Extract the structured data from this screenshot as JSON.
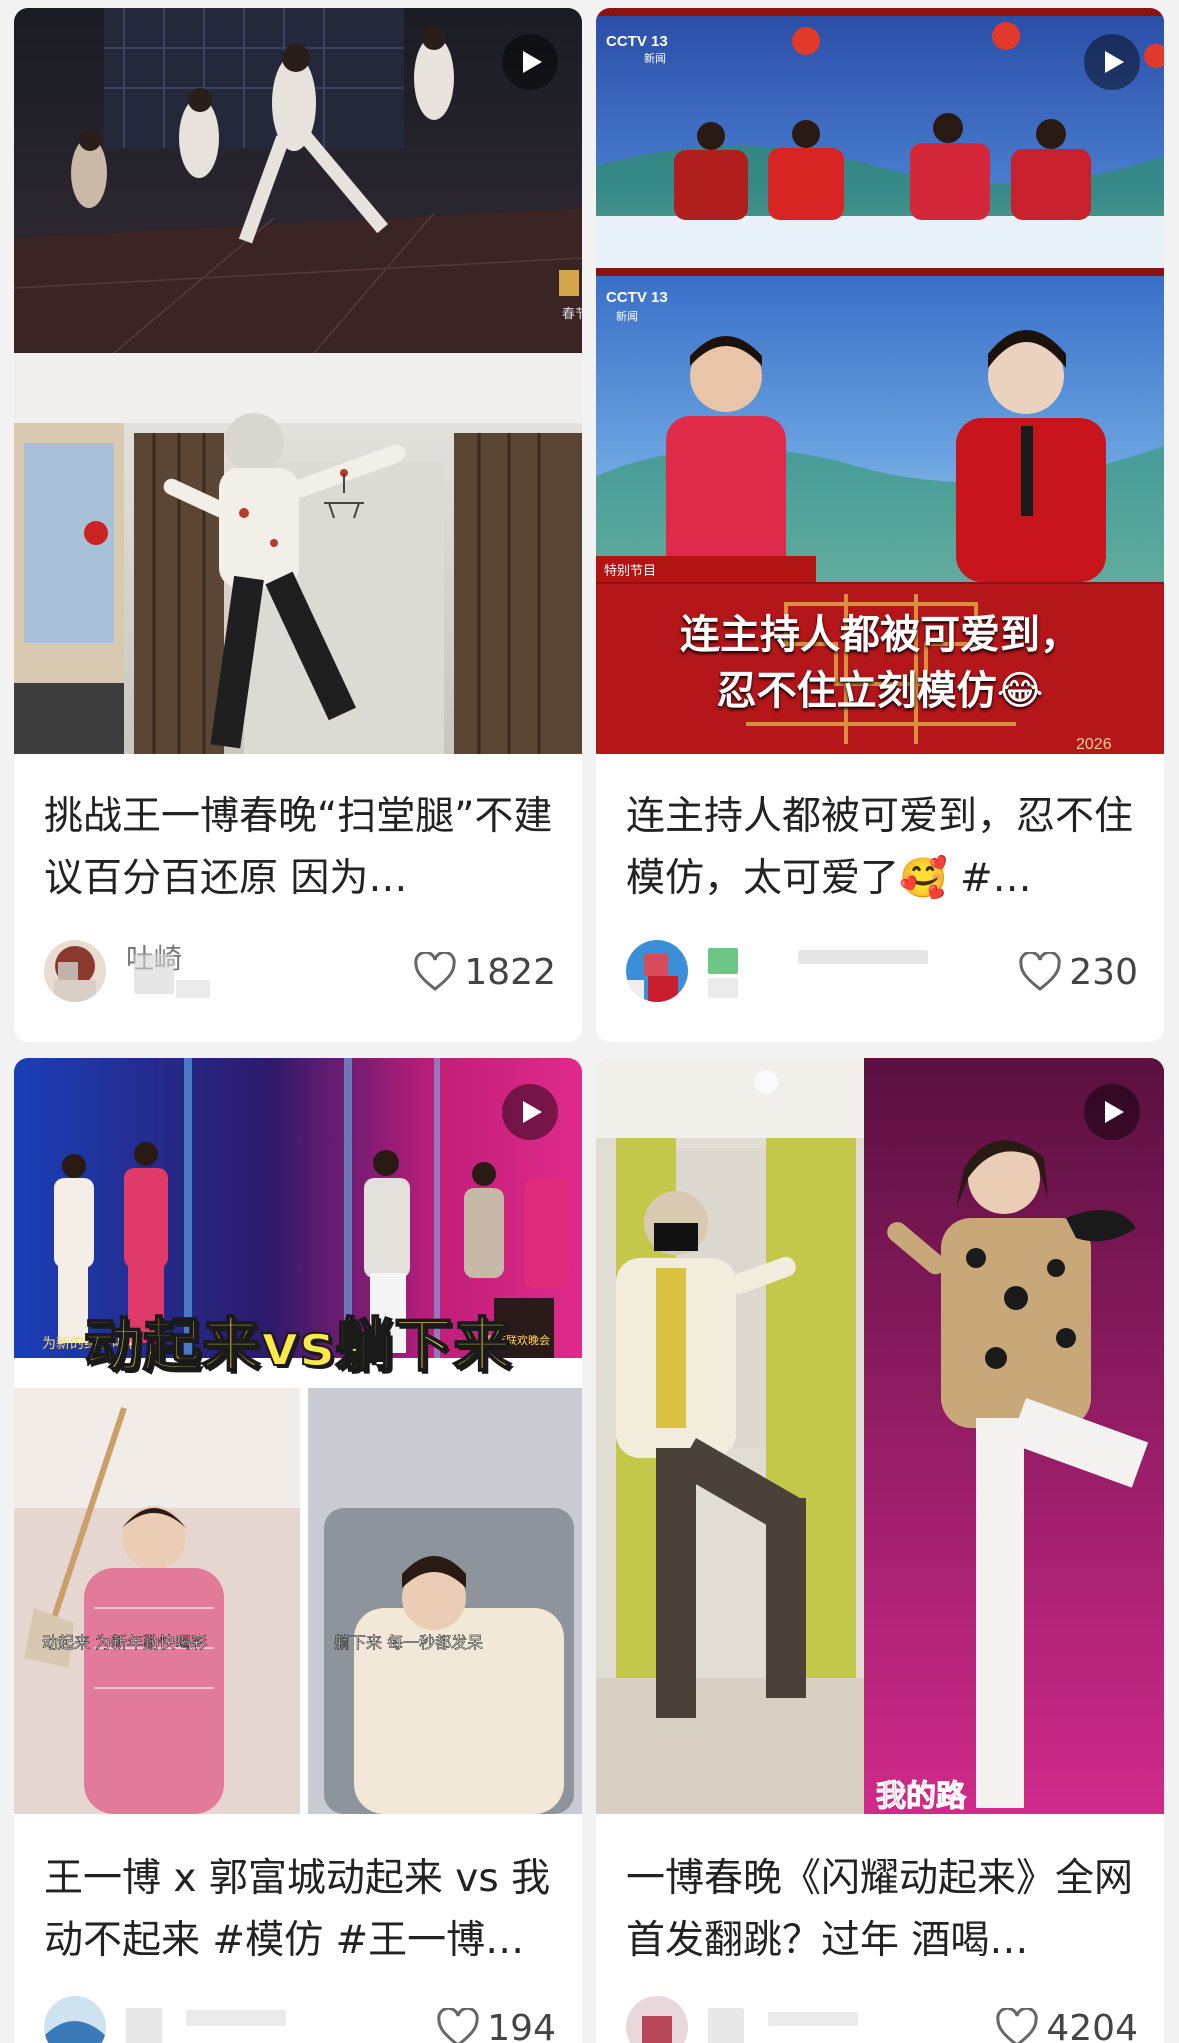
{
  "cards": [
    {
      "title": "挑战王一博春晚“扫堂腿”不建议百分百还原 因为…",
      "author": "吐崎",
      "likes": "1822",
      "thumb_labels": [
        "春节联"
      ]
    },
    {
      "title": "连主持人都被可爱到，忍不住模仿，太可爱了🥰 #…",
      "author": "",
      "likes": "230",
      "thumb_labels": [
        "CCTV 13",
        "新闻",
        "CCTV 13",
        "新闻",
        "特别节目",
        "连主持人都被可爱到，",
        "忍不住立刻模仿😂",
        "2026"
      ]
    },
    {
      "title": "王一博 x 郭富城动起来 vs 我动不起来 #模仿 #王一博…",
      "author": "",
      "likes": "194",
      "thumb_labels": [
        "为新的纪录喝彩",
        "春节联欢晚会",
        "动起来vs躺下来",
        "动起来 为新年勤快喝彩",
        "躺下来 每一秒都发呆"
      ]
    },
    {
      "title": "一博春晚《闪耀动起来》全网首发翻跳？过年 酒喝…",
      "author": "",
      "likes": "4204",
      "thumb_labels": [
        "我的路"
      ]
    }
  ]
}
